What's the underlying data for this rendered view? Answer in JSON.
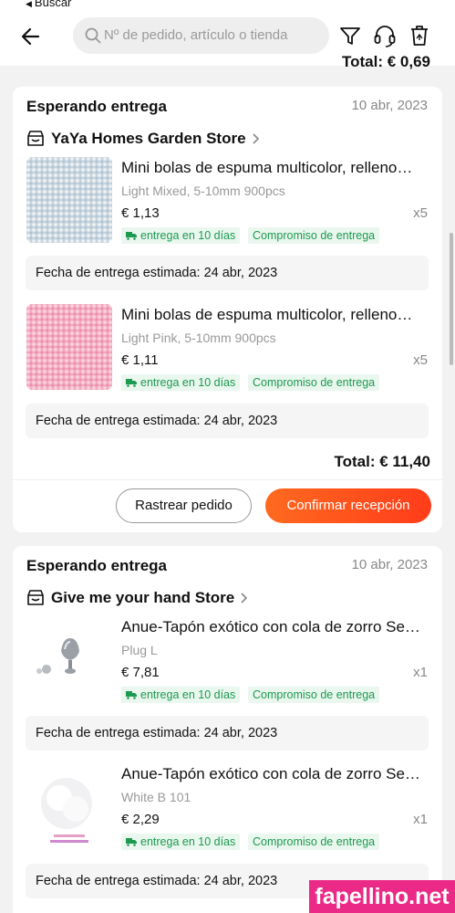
{
  "status_bar": {
    "back_app_label": "Buscar"
  },
  "header": {
    "search_placeholder": "Nº de pedido, artículo o tienda",
    "icons": [
      "back-arrow-icon",
      "search-icon",
      "filter-icon",
      "support-headset-icon",
      "trash-icon"
    ]
  },
  "previous_total": "Total: € 0,69",
  "orders": [
    {
      "status": "Esperando entrega",
      "date": "10 abr, 2023",
      "store": "YaYa Homes Garden Store",
      "items": [
        {
          "title": "Mini bolas de espuma multicolor, relleno…",
          "variant": "Light Mixed, 5-10mm 900pcs",
          "price": "€ 1,13",
          "qty": "x5",
          "tag_delivery": "entrega en 10 días",
          "tag_commit": "Compromiso de entrega",
          "estimate": "Fecha de entrega estimada: 24 abr, 2023",
          "thumb_color": "#c8d3dc"
        },
        {
          "title": "Mini bolas de espuma multicolor, relleno…",
          "variant": "Light Pink, 5-10mm 900pcs",
          "price": "€ 1,11",
          "qty": "x5",
          "tag_delivery": "entrega en 10 días",
          "tag_commit": "Compromiso de entrega",
          "estimate": "Fecha de entrega estimada: 24 abr, 2023",
          "thumb_color": "#f2a9c0"
        }
      ],
      "total": "Total: € 11,40",
      "btn_track": "Rastrear pedido",
      "btn_confirm": "Confirmar recepción"
    },
    {
      "status": "Esperando entrega",
      "date": "10 abr, 2023",
      "store": "Give me your hand Store",
      "items": [
        {
          "title": "Anue-Tapón exótico con cola de zorro Se…",
          "variant": "Plug L",
          "price": "€ 7,81",
          "qty": "x1",
          "tag_delivery": "entrega en 10 días",
          "tag_commit": "Compromiso de entrega",
          "estimate": "Fecha de entrega estimada: 24 abr, 2023"
        },
        {
          "title": "Anue-Tapón exótico con cola de zorro Se…",
          "variant": "White B 101",
          "price": "€ 2,29",
          "qty": "x1",
          "tag_delivery": "entrega en 10 días",
          "tag_commit": "Compromiso de entrega",
          "estimate": "Fecha de entrega estimada: 24 abr, 2023"
        }
      ]
    }
  ],
  "watermark": "fapellino.net",
  "colors": {
    "accent": "#ff4a1c",
    "tag_green": "#1c9a4f",
    "watermark": "#ea2a86"
  }
}
